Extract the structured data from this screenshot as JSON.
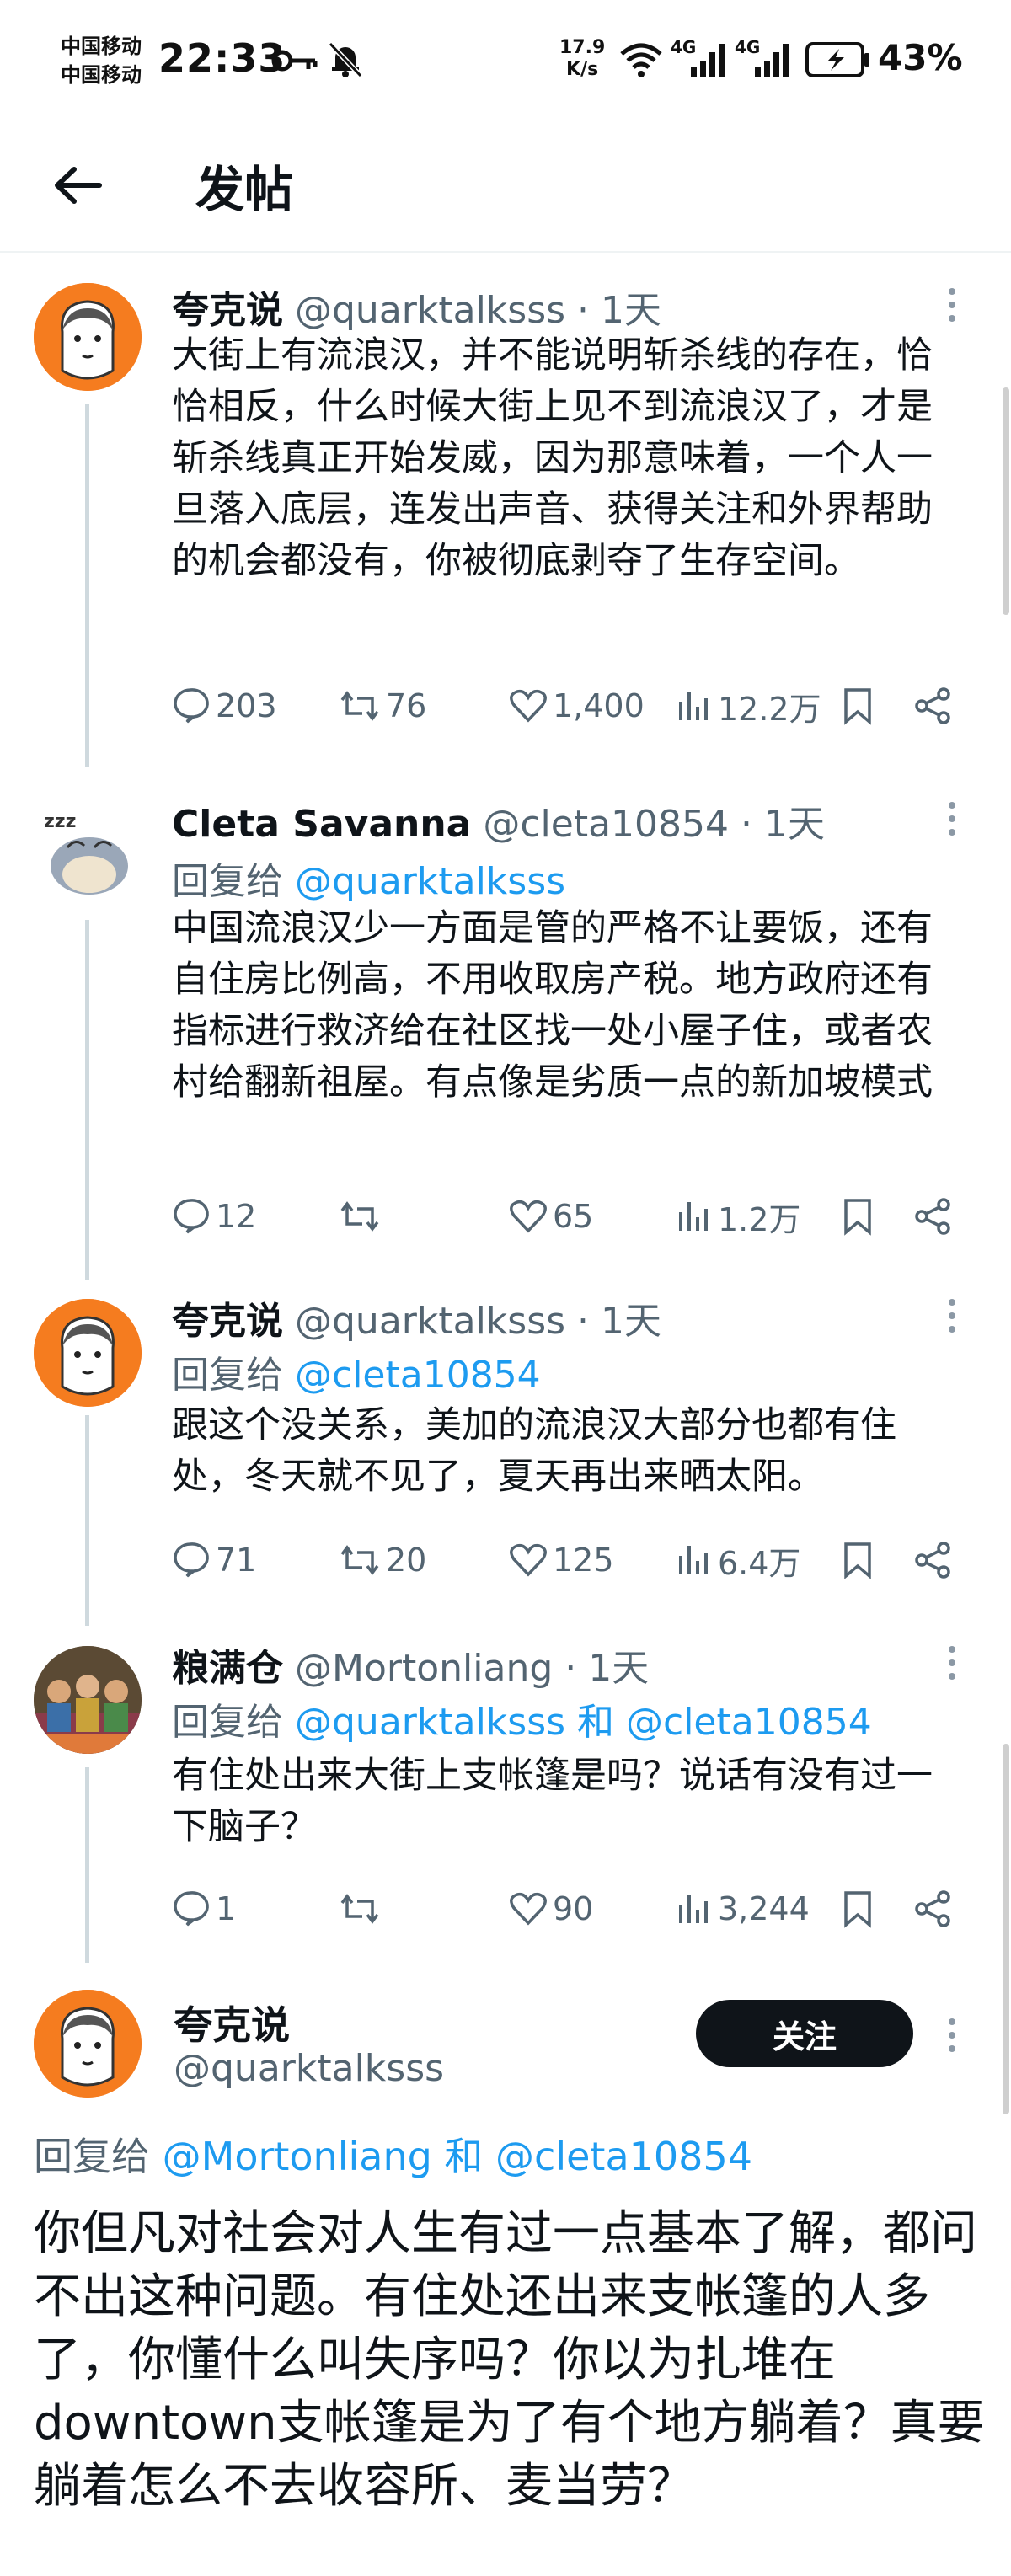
{
  "status_bar": {
    "carrier_1": "中国移动",
    "carrier_2": "中国移动",
    "time": "22:33",
    "net_speed_value": "17.9",
    "net_speed_unit": "K/s",
    "battery_percent": "43%",
    "signal_1_label": "4G",
    "signal_2_label": "4G"
  },
  "header": {
    "title": "发帖"
  },
  "tweets": [
    {
      "name": "夸克说",
      "meta": "@quarktalksss · 1天",
      "reply_prefix": "",
      "reply_to": "",
      "text": "大街上有流浪汉，并不能说明斩杀线的存在，恰恰相反，什么时候大街上见不到流浪汉了，才是斩杀线真正开始发威，因为那意味着，一个人一旦落入底层，连发出声音、获得关注和外界帮助的机会都没有，你被彻底剥夺了生存空间。",
      "replies": "203",
      "retweets": "76",
      "likes": "1,400",
      "views": "12.2万"
    },
    {
      "name": "Cleta Savanna",
      "meta": "@cleta10854 · 1天",
      "reply_prefix": "回复给 ",
      "reply_to": "@quarktalksss",
      "text": "中国流浪汉少一方面是管的严格不让要饭，还有自住房比例高，不用收取房产税。地方政府还有指标进行救济给在社区找一处小屋子住，或者农村给翻新祖屋。有点像是劣质一点的新加坡模式",
      "replies": "12",
      "retweets": "",
      "likes": "65",
      "views": "1.2万"
    },
    {
      "name": "夸克说",
      "meta": "@quarktalksss · 1天",
      "reply_prefix": "回复给 ",
      "reply_to": "@cleta10854",
      "text": "跟这个没关系，美加的流浪汉大部分也都有住处，冬天就不见了，夏天再出来晒太阳。",
      "replies": "71",
      "retweets": "20",
      "likes": "125",
      "views": "6.4万"
    },
    {
      "name": "粮满仓",
      "meta": "@Mortonliang · 1天",
      "reply_prefix": "回复给 ",
      "reply_to": "@quarktalksss 和 @cleta10854",
      "text": "有住处出来大街上支帐篷是吗？说话有没有过一下脑子？",
      "replies": "1",
      "retweets": "",
      "likes": "90",
      "views": "3,244"
    }
  ],
  "main_tweet": {
    "name": "夸克说",
    "handle": "@quarktalksss",
    "follow_label": "关注",
    "reply_prefix": "回复给 ",
    "reply_to": "@Mortonliang 和 @cleta10854",
    "text": "你但凡对社会对人生有过一点基本了解，都问不出这种问题。有住处还出来支帐篷的人多了，你懂什么叫失序吗？你以为扎堆在downtown支帐篷是为了有个地方躺着？真要躺着怎么不去收容所、麦当劳？"
  },
  "colors": {
    "text_primary": "#0f1419",
    "text_secondary": "#536471",
    "link": "#1d9bf0",
    "follow_button_bg": "#0f1419",
    "thread_line": "#cfd9de"
  }
}
